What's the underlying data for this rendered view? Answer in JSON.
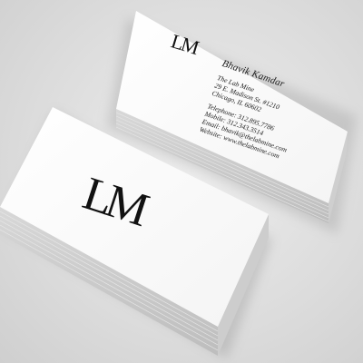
{
  "front_card": {
    "logo": "LM"
  },
  "back_card": {
    "logo": "LM",
    "name": "Bhavik Kamdar",
    "address": [
      "The Lab Mine",
      "29 E. Madison St. #1210",
      "Chicago, IL 60602"
    ],
    "contact": [
      "Telephone: 312.895.7786",
      "Mobile: 312.343.3514",
      "Email: bhavik@thelabmine.com",
      "Website: www.thelabmine.com"
    ]
  },
  "colors": {
    "background": "#dcdcdc",
    "card": "#ffffff",
    "ink": "#111111"
  }
}
